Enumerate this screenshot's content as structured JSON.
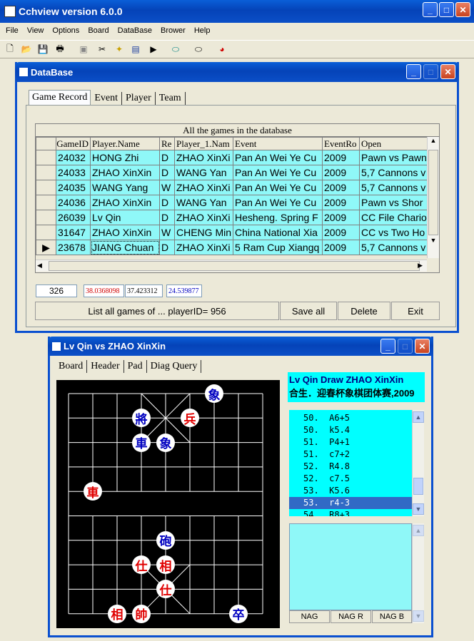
{
  "main_window": {
    "title": "Cchview version 6.0.0",
    "menu": [
      "File",
      "View",
      "Options",
      "Board",
      "DataBase",
      "Brower",
      "Help"
    ]
  },
  "toolbar": {
    "icons": [
      "new-icon",
      "open-icon",
      "save-icon",
      "print-icon",
      "gray-icon",
      "cut-icon",
      "copy-icon",
      "paste-icon",
      "play-icon",
      "cylinder-icon",
      "cylinder2-icon",
      "pie-icon"
    ]
  },
  "db_window": {
    "title": "DataBase",
    "tabs": [
      "Game Record",
      "Event",
      "Player",
      "Team"
    ],
    "grid_caption": "All the games in the database",
    "columns": [
      "GameID",
      "Player.Name",
      "Re",
      "Player_1.Nam",
      "Event",
      "EventRo",
      "Open"
    ],
    "rows": [
      [
        "24032",
        "HONG Zhi",
        "D",
        "ZHAO XinXi",
        "Pan An Wei Ye Cu",
        "2009",
        "Pawn vs Pawn"
      ],
      [
        "24033",
        "ZHAO XinXin",
        "D",
        "WANG Yan",
        "Pan An Wei Ye Cu",
        "2009",
        "5,7 Cannons v"
      ],
      [
        "24035",
        "WANG Yang",
        "W",
        "ZHAO XinXi",
        "Pan An Wei Ye Cu",
        "2009",
        "5,7 Cannons v"
      ],
      [
        "24036",
        "ZHAO XinXin",
        "D",
        "WANG Yan",
        "Pan An Wei Ye Cu",
        "2009",
        "Pawn vs Shor"
      ],
      [
        "26039",
        "Lv Qin",
        "D",
        "ZHAO XinXi",
        "Hesheng. Spring F",
        "2009",
        "CC File Chario"
      ],
      [
        "31647",
        "ZHAO XinXin",
        "W",
        "CHENG Min",
        "China National Xia",
        "2009",
        "CC vs Two Ho"
      ],
      [
        "23678",
        "JIANG Chuan",
        "D",
        "ZHAO XinXi",
        "5 Ram Cup Xiangq",
        "2009",
        "5,7 Cannons v"
      ]
    ],
    "selected_row": 6,
    "fields": {
      "count": "326",
      "f1": "38.0368098",
      "f2": "37.423312",
      "f3": "24.539877"
    },
    "buttons": {
      "list": "List all games of ... playerID= 956",
      "save": "Save all",
      "delete": "Delete",
      "exit": "Exit"
    }
  },
  "game_window": {
    "title": "Lv Qin  vs ZHAO XinXin",
    "tabs": [
      "Board",
      "Header",
      "Pad",
      "Diag Query"
    ],
    "result_line1": "Lv Qin  Draw ZHAO XinXin",
    "result_line2": "合生．迎春杯象棋团体赛,2009",
    "moves": [
      "50.  A6+5",
      "50.  k5.4",
      "51.  P4+1",
      "51.  c7+2",
      "52.  R4.8",
      "52.  c7.5",
      "53.  K5.6",
      "53.  r4-3",
      "54.  R8+3"
    ],
    "selected_move": 7,
    "nag_buttons": [
      "NAG",
      "NAG R",
      "NAG B"
    ],
    "pieces": [
      {
        "ch": "象",
        "side": "blue"
      },
      {
        "ch": "將",
        "side": "blue"
      },
      {
        "ch": "兵",
        "side": "red"
      },
      {
        "ch": "車",
        "side": "blue"
      },
      {
        "ch": "象",
        "side": "blue"
      },
      {
        "ch": "車",
        "side": "red"
      },
      {
        "ch": "砲",
        "side": "blue"
      },
      {
        "ch": "仕",
        "side": "red"
      },
      {
        "ch": "相",
        "side": "red"
      },
      {
        "ch": "仕",
        "side": "red"
      },
      {
        "ch": "相",
        "side": "red"
      },
      {
        "ch": "帥",
        "side": "red"
      },
      {
        "ch": "卒",
        "side": "blue"
      }
    ]
  },
  "colors": {
    "titlebar": "#0a5fd8",
    "cyan": "#00ffff",
    "selection": "#316ac5"
  }
}
